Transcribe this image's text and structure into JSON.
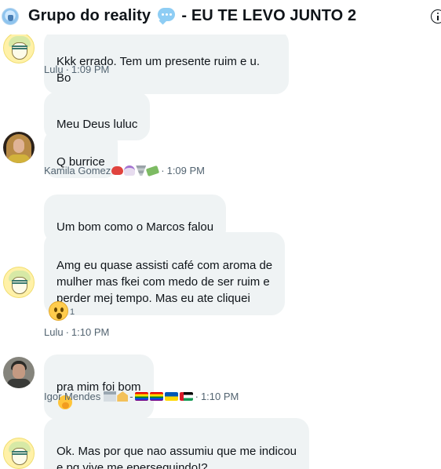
{
  "header": {
    "title_before": "Grupo do reality",
    "title_after": "- EU TE LEVO JUNTO 2",
    "title_emoji": "speech-bubble-icon",
    "group_avatar": "group-avatar",
    "info_icon": "info-icon"
  },
  "messages": [
    {
      "text": "Kkk errado. Tem um presente ruim e u. Bo"
    },
    {
      "text": "Meu Deus luluc"
    },
    {
      "text": "Q burrice"
    },
    {
      "text": "Um bom como o Marcos falou"
    },
    {
      "text": "Amg eu quase assisti café com aroma de\nmulher mas fkei com medo de ser ruim e\nperder mej tempo. Mas eu ate cliquei"
    },
    {
      "text": "pra mim foi bom",
      "emoji": "face-with-hand-over-mouth-icon"
    },
    {
      "text": "Ok. Mas por que nao assumiu que me indicou\ne pq vive me eperseguindo!?"
    }
  ],
  "meta": [
    {
      "sender": "Lulu",
      "separator": "·",
      "time": "1:09 PM"
    },
    {
      "sender": "Kamila Gomez",
      "sender_emojis": [
        "crab-icon",
        "unicorn-icon",
        "tornado-icon",
        "money-icon"
      ],
      "separator": "·",
      "time": "1:09 PM"
    },
    {
      "sender": "Lulu",
      "separator": "·",
      "time": "1:10 PM"
    },
    {
      "sender": "Igor Mendes",
      "sender_emojis": [
        "bank-icon",
        "house-icon",
        "rainbow-flag-icon",
        "rainbow-flag-icon",
        "ukraine-flag-icon",
        "palestine-flag-icon"
      ],
      "sender_dash": "-",
      "separator": "·",
      "time": "1:10 PM"
    }
  ],
  "reaction": {
    "emoji": "astonished-face-icon",
    "count": "1"
  },
  "colors": {
    "bubble": "#eff3f4",
    "text": "#0f1419",
    "meta": "#536471",
    "background": "#ffffff"
  }
}
